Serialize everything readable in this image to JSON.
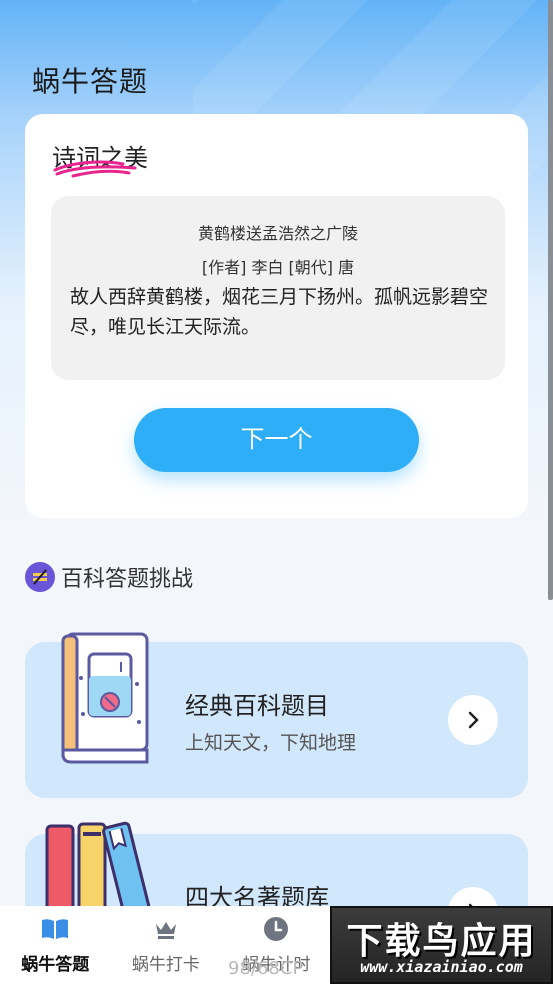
{
  "app": {
    "title": "蜗牛答题"
  },
  "poem_section": {
    "header": "诗词之美",
    "poem_title": "黄鹤楼送孟浩然之广陵",
    "meta": "[作者] 李白 [朝代] 唐",
    "text": "故人西辞黄鹤楼，烟花三月下扬州。孤帆远影碧空尽，唯见长江天际流。",
    "next_label": "下一个"
  },
  "challenge": {
    "title": "百科答题挑战",
    "cards": [
      {
        "title": "经典百科题目",
        "subtitle": "上知天文，下知地理",
        "icon": "book-icon"
      },
      {
        "title": "四大名著题库",
        "subtitle": "",
        "icon": "books-icon"
      }
    ]
  },
  "tabs": [
    {
      "label": "蜗牛答题",
      "icon": "open-book-icon",
      "active": true
    },
    {
      "label": "蜗牛打卡",
      "icon": "crown-icon",
      "active": false
    },
    {
      "label": "蜗牛计时",
      "icon": "clock-icon",
      "active": false
    },
    {
      "label": "",
      "icon": "",
      "active": false
    },
    {
      "label": "",
      "icon": "",
      "active": false
    }
  ],
  "watermark": {
    "number": "98/68CP",
    "title": "下载鸟应用",
    "url": "www.xiazainiao.com"
  },
  "colors": {
    "accent": "#2daef7",
    "card_bg": "#d1e8fc",
    "active_tab": "#3a8ee6"
  }
}
